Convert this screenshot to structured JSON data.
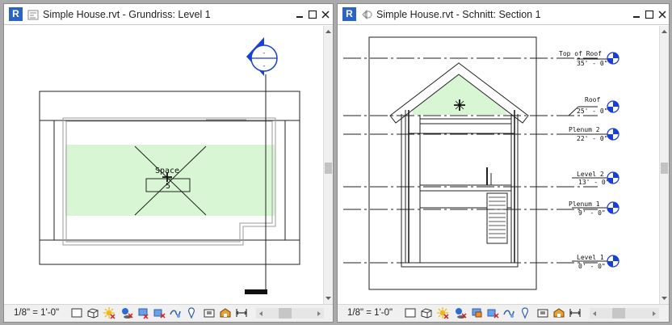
{
  "windows": {
    "plan": {
      "title": "Simple House.rvt - Grundriss: Level 1",
      "scale": "1/8\" = 1'-0\"",
      "space_label": "Space",
      "space_number": "5",
      "section_head_label": "-"
    },
    "section": {
      "title": "Simple House.rvt - Schnitt: Section 1",
      "scale": "1/8\" = 1'-0\"",
      "levels": [
        {
          "name": "Top of Roof",
          "elevation": "35' - 0\""
        },
        {
          "name": "Roof",
          "elevation": "25' - 0\""
        },
        {
          "name": "Plenum 2",
          "elevation": "22' - 0\""
        },
        {
          "name": "Level 2",
          "elevation": "13' - 0\""
        },
        {
          "name": "Plenum 1",
          "elevation": "9' - 0\""
        },
        {
          "name": "Level 1",
          "elevation": "0' - 0\""
        }
      ]
    }
  },
  "colors": {
    "space_fill": "#d8f5d4",
    "app_icon": "#2b63c4",
    "level_head": "#1a3fd6"
  }
}
